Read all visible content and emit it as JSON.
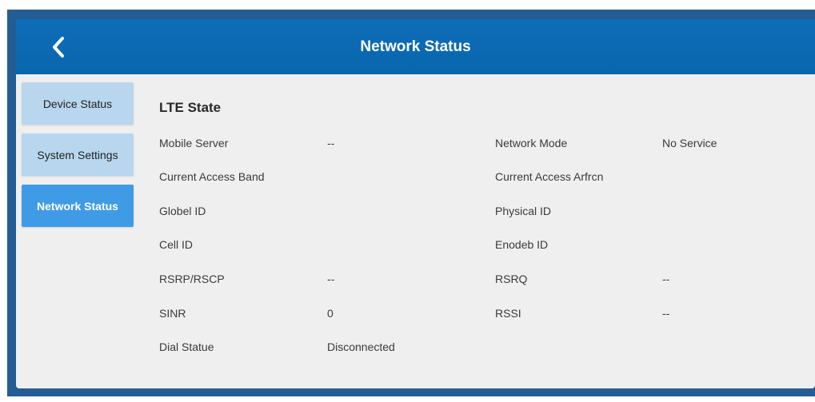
{
  "header": {
    "title": "Network Status",
    "back_icon": "chevron-left-icon"
  },
  "sidebar": {
    "items": [
      {
        "label": "Device Status",
        "active": false
      },
      {
        "label": "System Settings",
        "active": false
      },
      {
        "label": "Network Status",
        "active": true
      }
    ]
  },
  "section": {
    "title": "LTE State"
  },
  "left": [
    {
      "label": "Mobile Server",
      "value": "--"
    },
    {
      "label": "Current Access Band",
      "value": ""
    },
    {
      "label": "Globel ID",
      "value": ""
    },
    {
      "label": "Cell ID",
      "value": ""
    },
    {
      "label": "RSRP/RSCP",
      "value": "--"
    },
    {
      "label": "SINR",
      "value": "0"
    },
    {
      "label": "Dial Statue",
      "value": "Disconnected"
    }
  ],
  "right": [
    {
      "label": "Network Mode",
      "value": "No Service"
    },
    {
      "label": "Current Access Arfrcn",
      "value": ""
    },
    {
      "label": "Physical ID",
      "value": ""
    },
    {
      "label": "Enodeb ID",
      "value": ""
    },
    {
      "label": "RSRQ",
      "value": "--"
    },
    {
      "label": "RSSI",
      "value": "--"
    }
  ],
  "colors": {
    "header": "#0d6db7",
    "frame": "#245d93",
    "active_nav": "#3f9be5",
    "nav": "#b8d6ed",
    "panel": "#efefef"
  }
}
